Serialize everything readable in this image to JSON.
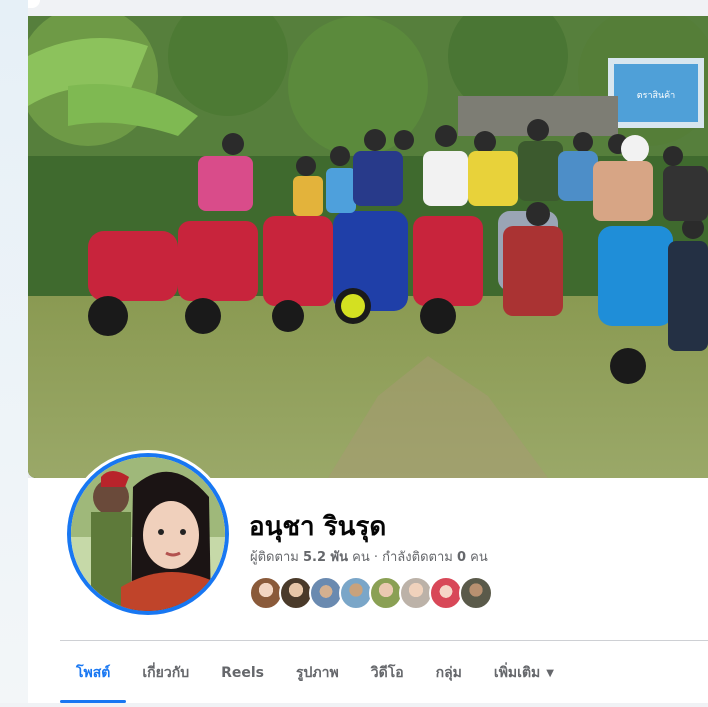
{
  "profile": {
    "name": "อนุชา รินรุด",
    "followers_label": "ผู้ติดตาม",
    "followers_count": "5.2 พัน",
    "followers_unit": "คน",
    "separator": "·",
    "following_label": "กำลังติดตาม",
    "following_count": "0",
    "following_unit": "คน"
  },
  "tabs": [
    {
      "label": "โพสต์",
      "active": true
    },
    {
      "label": "เกี่ยวกับ"
    },
    {
      "label": "Reels"
    },
    {
      "label": "รูปภาพ"
    },
    {
      "label": "วิดีโอ"
    },
    {
      "label": "กลุ่ม"
    },
    {
      "label": "เพิ่มเติม",
      "icon": "caret-down-icon"
    }
  ],
  "cover": {
    "banner_text": "ตราสินค้า"
  },
  "colors": {
    "accent": "#1877f2",
    "text_primary": "#050505",
    "text_secondary": "#65676b"
  }
}
